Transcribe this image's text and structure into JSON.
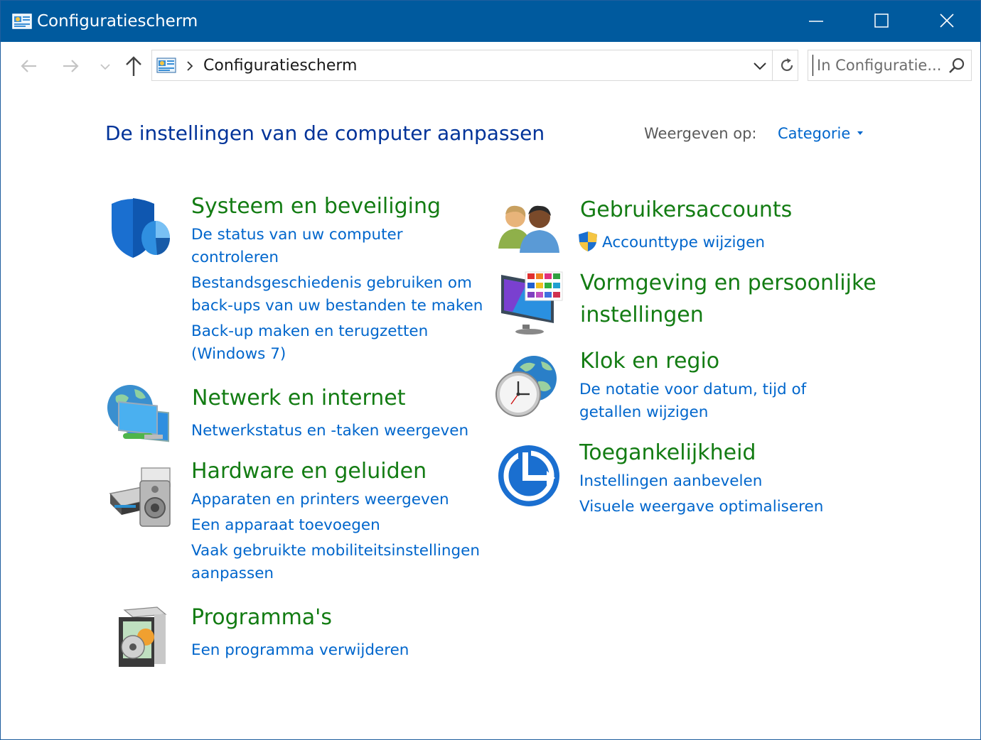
{
  "window": {
    "title": "Configuratiescherm"
  },
  "address": {
    "breadcrumb": "Configuratiescherm",
    "search_placeholder": "In Configuratie..."
  },
  "page": {
    "heading": "De instellingen van de computer aanpassen",
    "view_by_label": "Weergeven op:",
    "view_by_value": "Categorie"
  },
  "categories": {
    "system": {
      "title": "Systeem en beveiliging",
      "links": [
        "De status van uw computer",
        "controleren",
        "Bestandsgeschiedenis gebruiken om",
        "back-ups van uw bestanden te maken",
        "Back-up maken en terugzetten",
        "(Windows 7)"
      ]
    },
    "network": {
      "title": "Netwerk en internet",
      "links": [
        "Netwerkstatus en -taken weergeven"
      ]
    },
    "hardware": {
      "title": "Hardware en geluiden",
      "links": [
        "Apparaten en printers weergeven",
        "Een apparaat toevoegen",
        "Vaak gebruikte mobiliteitsinstellingen",
        "aanpassen"
      ]
    },
    "programs": {
      "title": "Programma's",
      "links": [
        "Een programma verwijderen"
      ]
    },
    "accounts": {
      "title": "Gebruikersaccounts",
      "links": [
        "Accounttype wijzigen"
      ]
    },
    "appearance": {
      "title_line1": "Vormgeving en persoonlijke",
      "title_line2": "instellingen"
    },
    "clock": {
      "title": "Klok en regio",
      "links": [
        "De notatie voor datum, tijd of",
        "getallen wijzigen"
      ]
    },
    "access": {
      "title": "Toegankelijkheid",
      "links": [
        "Instellingen aanbevelen",
        "Visuele weergave optimaliseren"
      ]
    }
  },
  "colors": {
    "titlebar": "#005a9e",
    "heading": "#003399",
    "category": "#137c13",
    "link": "#0066cc"
  }
}
